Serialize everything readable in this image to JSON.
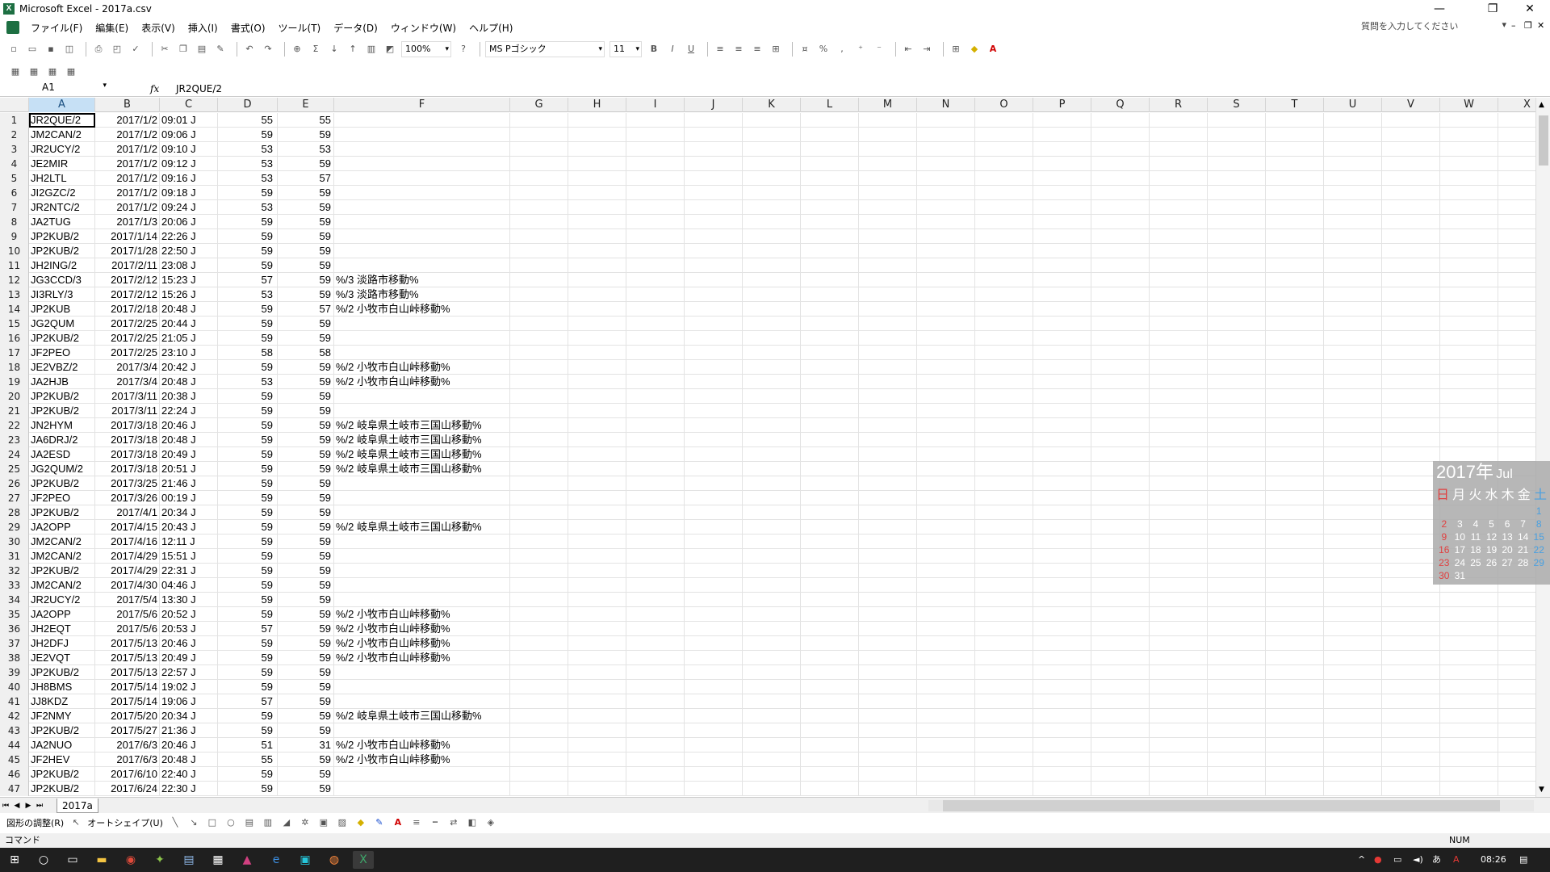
{
  "window": {
    "title": "Microsoft Excel - 2017a.csv"
  },
  "menu": {
    "items": [
      "ファイル(F)",
      "編集(E)",
      "表示(V)",
      "挿入(I)",
      "書式(O)",
      "ツール(T)",
      "データ(D)",
      "ウィンドウ(W)",
      "ヘルプ(H)"
    ],
    "help_placeholder": "質問を入力してください"
  },
  "toolbar": {
    "zoom": "100%",
    "font_name": "MS Pゴシック",
    "font_size": "11"
  },
  "formula_bar": {
    "name_box": "A1",
    "fx": "fx",
    "value": "JR2QUE/2"
  },
  "columns": [
    "A",
    "B",
    "C",
    "D",
    "E",
    "F",
    "G",
    "H",
    "I",
    "J",
    "K",
    "L",
    "M",
    "N",
    "O",
    "P",
    "Q",
    "R",
    "S",
    "T",
    "U",
    "V",
    "W",
    "X"
  ],
  "rows": [
    {
      "n": "1",
      "a": "JR2QUE/2",
      "b": "2017/1/2",
      "c": "09:01 J",
      "d": "55",
      "e": "55",
      "f": ""
    },
    {
      "n": "2",
      "a": "JM2CAN/2",
      "b": "2017/1/2",
      "c": "09:06 J",
      "d": "59",
      "e": "59",
      "f": ""
    },
    {
      "n": "3",
      "a": "JR2UCY/2",
      "b": "2017/1/2",
      "c": "09:10 J",
      "d": "53",
      "e": "53",
      "f": ""
    },
    {
      "n": "4",
      "a": "JE2MIR",
      "b": "2017/1/2",
      "c": "09:12 J",
      "d": "53",
      "e": "59",
      "f": ""
    },
    {
      "n": "5",
      "a": "JH2LTL",
      "b": "2017/1/2",
      "c": "09:16 J",
      "d": "53",
      "e": "57",
      "f": ""
    },
    {
      "n": "6",
      "a": "JI2GZC/2",
      "b": "2017/1/2",
      "c": "09:18 J",
      "d": "59",
      "e": "59",
      "f": ""
    },
    {
      "n": "7",
      "a": "JR2NTC/2",
      "b": "2017/1/2",
      "c": "09:24 J",
      "d": "53",
      "e": "59",
      "f": ""
    },
    {
      "n": "8",
      "a": "JA2TUG",
      "b": "2017/1/3",
      "c": "20:06 J",
      "d": "59",
      "e": "59",
      "f": ""
    },
    {
      "n": "9",
      "a": "JP2KUB/2",
      "b": "2017/1/14",
      "c": "22:26 J",
      "d": "59",
      "e": "59",
      "f": ""
    },
    {
      "n": "10",
      "a": "JP2KUB/2",
      "b": "2017/1/28",
      "c": "22:50 J",
      "d": "59",
      "e": "59",
      "f": ""
    },
    {
      "n": "11",
      "a": "JH2ING/2",
      "b": "2017/2/11",
      "c": "23:08 J",
      "d": "59",
      "e": "59",
      "f": ""
    },
    {
      "n": "12",
      "a": "JG3CCD/3",
      "b": "2017/2/12",
      "c": "15:23 J",
      "d": "57",
      "e": "59",
      "f": "%/3 淡路市移動%"
    },
    {
      "n": "13",
      "a": "JI3RLY/3",
      "b": "2017/2/12",
      "c": "15:26 J",
      "d": "53",
      "e": "59",
      "f": "%/3 淡路市移動%"
    },
    {
      "n": "14",
      "a": "JP2KUB",
      "b": "2017/2/18",
      "c": "20:48 J",
      "d": "59",
      "e": "57",
      "f": "%/2 小牧市白山峠移動%"
    },
    {
      "n": "15",
      "a": "JG2QUM",
      "b": "2017/2/25",
      "c": "20:44 J",
      "d": "59",
      "e": "59",
      "f": ""
    },
    {
      "n": "16",
      "a": "JP2KUB/2",
      "b": "2017/2/25",
      "c": "21:05 J",
      "d": "59",
      "e": "59",
      "f": ""
    },
    {
      "n": "17",
      "a": "JF2PEO",
      "b": "2017/2/25",
      "c": "23:10 J",
      "d": "58",
      "e": "58",
      "f": ""
    },
    {
      "n": "18",
      "a": "JE2VBZ/2",
      "b": "2017/3/4",
      "c": "20:42 J",
      "d": "59",
      "e": "59",
      "f": "%/2 小牧市白山峠移動%"
    },
    {
      "n": "19",
      "a": "JA2HJB",
      "b": "2017/3/4",
      "c": "20:48 J",
      "d": "53",
      "e": "59",
      "f": "%/2 小牧市白山峠移動%"
    },
    {
      "n": "20",
      "a": "JP2KUB/2",
      "b": "2017/3/11",
      "c": "20:38 J",
      "d": "59",
      "e": "59",
      "f": ""
    },
    {
      "n": "21",
      "a": "JP2KUB/2",
      "b": "2017/3/11",
      "c": "22:24 J",
      "d": "59",
      "e": "59",
      "f": ""
    },
    {
      "n": "22",
      "a": "JN2HYM",
      "b": "2017/3/18",
      "c": "20:46 J",
      "d": "59",
      "e": "59",
      "f": "%/2 岐阜県土岐市三国山移動%"
    },
    {
      "n": "23",
      "a": "JA6DRJ/2",
      "b": "2017/3/18",
      "c": "20:48 J",
      "d": "59",
      "e": "59",
      "f": "%/2 岐阜県土岐市三国山移動%"
    },
    {
      "n": "24",
      "a": "JA2ESD",
      "b": "2017/3/18",
      "c": "20:49 J",
      "d": "59",
      "e": "59",
      "f": "%/2 岐阜県土岐市三国山移動%"
    },
    {
      "n": "25",
      "a": "JG2QUM/2",
      "b": "2017/3/18",
      "c": "20:51 J",
      "d": "59",
      "e": "59",
      "f": "%/2 岐阜県土岐市三国山移動%"
    },
    {
      "n": "26",
      "a": "JP2KUB/2",
      "b": "2017/3/25",
      "c": "21:46 J",
      "d": "59",
      "e": "59",
      "f": ""
    },
    {
      "n": "27",
      "a": "JF2PEO",
      "b": "2017/3/26",
      "c": "00:19 J",
      "d": "59",
      "e": "59",
      "f": ""
    },
    {
      "n": "28",
      "a": "JP2KUB/2",
      "b": "2017/4/1",
      "c": "20:34 J",
      "d": "59",
      "e": "59",
      "f": ""
    },
    {
      "n": "29",
      "a": "JA2OPP",
      "b": "2017/4/15",
      "c": "20:43 J",
      "d": "59",
      "e": "59",
      "f": "%/2 岐阜県土岐市三国山移動%"
    },
    {
      "n": "30",
      "a": "JM2CAN/2",
      "b": "2017/4/16",
      "c": "12:11 J",
      "d": "59",
      "e": "59",
      "f": ""
    },
    {
      "n": "31",
      "a": "JM2CAN/2",
      "b": "2017/4/29",
      "c": "15:51 J",
      "d": "59",
      "e": "59",
      "f": ""
    },
    {
      "n": "32",
      "a": "JP2KUB/2",
      "b": "2017/4/29",
      "c": "22:31 J",
      "d": "59",
      "e": "59",
      "f": ""
    },
    {
      "n": "33",
      "a": "JM2CAN/2",
      "b": "2017/4/30",
      "c": "04:46 J",
      "d": "59",
      "e": "59",
      "f": ""
    },
    {
      "n": "34",
      "a": "JR2UCY/2",
      "b": "2017/5/4",
      "c": "13:30 J",
      "d": "59",
      "e": "59",
      "f": ""
    },
    {
      "n": "35",
      "a": "JA2OPP",
      "b": "2017/5/6",
      "c": "20:52 J",
      "d": "59",
      "e": "59",
      "f": "%/2 小牧市白山峠移動%"
    },
    {
      "n": "36",
      "a": "JH2EQT",
      "b": "2017/5/6",
      "c": "20:53 J",
      "d": "57",
      "e": "59",
      "f": "%/2 小牧市白山峠移動%"
    },
    {
      "n": "37",
      "a": "JH2DFJ",
      "b": "2017/5/13",
      "c": "20:46 J",
      "d": "59",
      "e": "59",
      "f": "%/2 小牧市白山峠移動%"
    },
    {
      "n": "38",
      "a": "JE2VQT",
      "b": "2017/5/13",
      "c": "20:49 J",
      "d": "59",
      "e": "59",
      "f": "%/2 小牧市白山峠移動%"
    },
    {
      "n": "39",
      "a": "JP2KUB/2",
      "b": "2017/5/13",
      "c": "22:57 J",
      "d": "59",
      "e": "59",
      "f": ""
    },
    {
      "n": "40",
      "a": "JH8BMS",
      "b": "2017/5/14",
      "c": "19:02 J",
      "d": "59",
      "e": "59",
      "f": ""
    },
    {
      "n": "41",
      "a": "JJ8KDZ",
      "b": "2017/5/14",
      "c": "19:06 J",
      "d": "57",
      "e": "59",
      "f": ""
    },
    {
      "n": "42",
      "a": "JF2NMY",
      "b": "2017/5/20",
      "c": "20:34 J",
      "d": "59",
      "e": "59",
      "f": "%/2 岐阜県土岐市三国山移動%"
    },
    {
      "n": "43",
      "a": "JP2KUB/2",
      "b": "2017/5/27",
      "c": "21:36 J",
      "d": "59",
      "e": "59",
      "f": ""
    },
    {
      "n": "44",
      "a": "JA2NUO",
      "b": "2017/6/3",
      "c": "20:46 J",
      "d": "51",
      "e": "31",
      "f": "%/2 小牧市白山峠移動%"
    },
    {
      "n": "45",
      "a": "JF2HEV",
      "b": "2017/6/3",
      "c": "20:48 J",
      "d": "55",
      "e": "59",
      "f": "%/2 小牧市白山峠移動%"
    },
    {
      "n": "46",
      "a": "JP2KUB/2",
      "b": "2017/6/10",
      "c": "22:40 J",
      "d": "59",
      "e": "59",
      "f": ""
    },
    {
      "n": "47",
      "a": "JP2KUB/2",
      "b": "2017/6/24",
      "c": "22:30 J",
      "d": "59",
      "e": "59",
      "f": ""
    }
  ],
  "sheet_tab": "2017a",
  "drawing_toolbar": {
    "adjust": "図形の調整(R)",
    "autoshape": "オートシェイプ(U)"
  },
  "status": {
    "mode": "コマンド",
    "num": "NUM"
  },
  "calendar": {
    "year": "2017年",
    "month": "Jul",
    "weekdays": [
      "日",
      "月",
      "火",
      "水",
      "木",
      "金",
      "土"
    ],
    "days": [
      "",
      "",
      "",
      "",
      "",
      "",
      "1",
      "2",
      "3",
      "4",
      "5",
      "6",
      "7",
      "8",
      "9",
      "10",
      "11",
      "12",
      "13",
      "14",
      "15",
      "16",
      "17",
      "18",
      "19",
      "20",
      "21",
      "22",
      "23",
      "24",
      "25",
      "26",
      "27",
      "28",
      "29",
      "30",
      "31"
    ]
  },
  "tray": {
    "ime": "あ",
    "time": "08:26"
  }
}
